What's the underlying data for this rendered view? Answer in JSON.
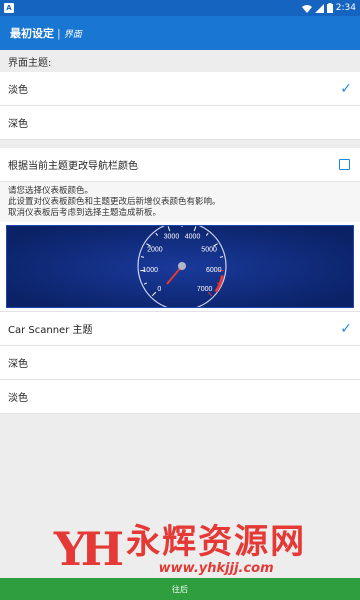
{
  "statusbar": {
    "time": "2:34",
    "app_icon": "A"
  },
  "appbar": {
    "title": "最初设定",
    "separator": "|",
    "subtitle": "界面"
  },
  "section": {
    "label": "界面主题:"
  },
  "theme_options": [
    {
      "label": "淡色",
      "selected": true
    },
    {
      "label": "深色",
      "selected": false
    }
  ],
  "navbar_option": {
    "label": "根据当前主题更改导航栏颜色",
    "checked": false
  },
  "note": {
    "line1": "请您选择仪表板颜色。",
    "line2": "此设置对仪表板颜色和主题更改后新增仪表颜色有影响。",
    "line3": "取消仪表板后考虑到选择主题造成新板。"
  },
  "gauge": {
    "tick_labels": [
      "0",
      "1000",
      "2000",
      "3000",
      "4000",
      "5000",
      "6000",
      "7000"
    ],
    "colors": {
      "background": "#0d2a78",
      "needle": "#e53935",
      "redline": "#e53935"
    }
  },
  "dash_options": [
    {
      "label": "Car Scanner 主题",
      "selected": true
    },
    {
      "label": "深色",
      "selected": false
    },
    {
      "label": "淡色",
      "selected": false
    }
  ],
  "watermark": {
    "logo": "YH",
    "text": "永辉资源网",
    "url": "www.yhkjjj.com"
  },
  "bottombar": {
    "label": "往后"
  },
  "colors": {
    "primary": "#1976d2",
    "accent": "#1e88e5",
    "bottom": "#2e9e3e"
  }
}
